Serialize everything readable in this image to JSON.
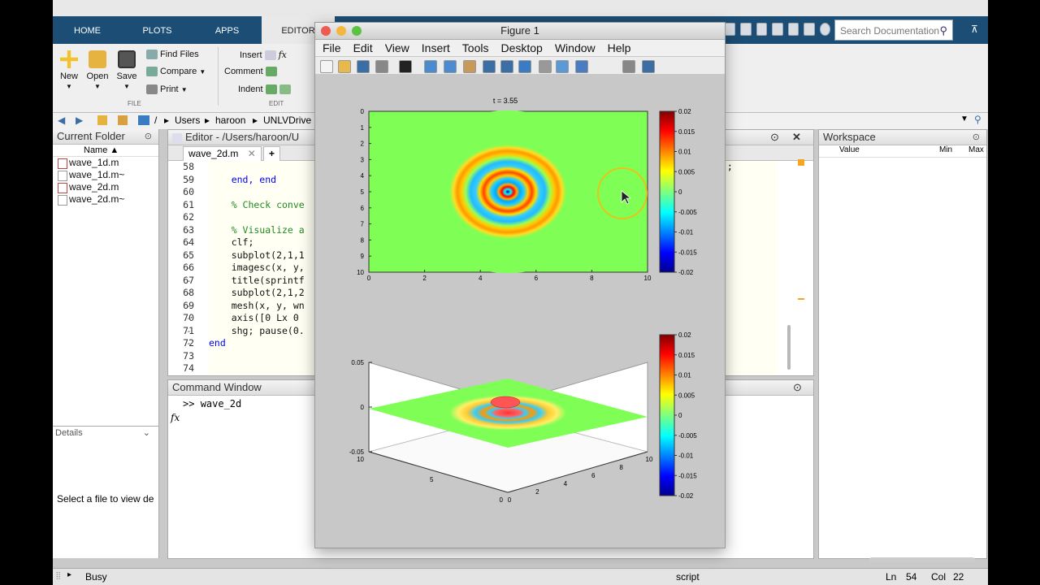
{
  "ribbon_tabs": [
    "HOME",
    "PLOTS",
    "APPS",
    "EDITOR"
  ],
  "search": {
    "placeholder": "Search Documentation"
  },
  "ribbon": {
    "new": "New",
    "open": "Open",
    "save": "Save",
    "find_files": "Find Files",
    "compare": "Compare",
    "print": "Print",
    "insert": "Insert",
    "comment": "Comment",
    "indent": "Indent",
    "fx": "fx",
    "group_file": "FILE",
    "group_edit": "EDIT"
  },
  "address": {
    "segments": [
      "/",
      "Users",
      "haroon",
      "UNLVDrive"
    ]
  },
  "current_folder": {
    "title": "Current Folder",
    "column": "Name ▲",
    "files": [
      "wave_1d.m",
      "wave_1d.m~",
      "wave_2d.m",
      "wave_2d.m~"
    ]
  },
  "details": {
    "title": "Details",
    "message": "Select a file to view de"
  },
  "editor": {
    "title": "Editor - /Users/haroon/U",
    "tab": "wave_2d.m",
    "line_numbers": [
      "58",
      "59",
      "60",
      "61",
      "62",
      "63",
      "64",
      "65",
      "66",
      "67",
      "68",
      "69",
      "70",
      "71",
      "72",
      "73",
      "74"
    ],
    "dashes": [
      "",
      "-",
      "",
      "",
      "",
      "-",
      "-",
      "-",
      "-",
      "-",
      "-",
      "-",
      "-",
      "-",
      "-",
      "",
      ""
    ],
    "code_visible": [
      "",
      "    end, end",
      "",
      "    % Check conve",
      "",
      "    % Visualize a",
      "    clf;",
      "    subplot(2,1,1",
      "    imagesc(x, y,",
      "    title(sprintf",
      "    subplot(2,1,2",
      "    mesh(x, y, wn",
      "    axis([0 Lx 0 ",
      "    shg; pause(0.",
      "end",
      "",
      ""
    ],
    "code_right_fragment": ");"
  },
  "command_window": {
    "title": "Command Window",
    "prompt": ">>",
    "command": "wave_2d",
    "fx": "fx"
  },
  "workspace": {
    "title": "Workspace",
    "columns": [
      "Value",
      "Min",
      "Max"
    ]
  },
  "status": {
    "left": "Busy",
    "mode": "script",
    "ln_label": "Ln",
    "ln": "54",
    "col_label": "Col",
    "col": "22"
  },
  "figure": {
    "title": "Figure 1",
    "menu": [
      "File",
      "Edit",
      "View",
      "Insert",
      "Tools",
      "Desktop",
      "Window",
      "Help"
    ],
    "tools_icons": [
      "new-figure-icon",
      "open-icon",
      "save-icon",
      "print-icon",
      "pointer-icon",
      "zoom-in-icon",
      "zoom-out-icon",
      "pan-icon",
      "rotate-icon",
      "data-cursor-icon",
      "brush-icon",
      "link-icon",
      "colorbar-icon",
      "legend-icon",
      "hide-tools-icon",
      "dock-icon"
    ]
  },
  "chart_data": [
    {
      "type": "heatmap",
      "title": "t = 3.55",
      "x_ticks": [
        0,
        2,
        4,
        6,
        8,
        10
      ],
      "y_ticks": [
        0,
        1,
        2,
        3,
        4,
        5,
        6,
        7,
        8,
        9,
        10
      ],
      "xlim": [
        0,
        10
      ],
      "ylim": [
        0,
        10
      ],
      "colorbar_ticks": [
        "0.02",
        "0.015",
        "0.01",
        "0.005",
        "0",
        "-0.005",
        "-0.01",
        "-0.015",
        "-0.02"
      ],
      "clim": [
        -0.02,
        0.02
      ],
      "description": "concentric wave rings centered at (5,5)"
    },
    {
      "type": "surface",
      "z_ticks": [
        "0.05",
        "0",
        "-0.05"
      ],
      "x_ticks": [
        "0",
        "2",
        "4",
        "6",
        "8",
        "10"
      ],
      "y_ticks": [
        "0",
        "5",
        "10"
      ],
      "zlim": [
        -0.05,
        0.05
      ],
      "colorbar_ticks": [
        "0.02",
        "0.015",
        "0.01",
        "0.005",
        "0",
        "-0.005",
        "-0.01",
        "-0.015",
        "-0.02"
      ]
    }
  ],
  "colors": {
    "tab_bar": "#1c4d75",
    "heat_bg": "#7fff55"
  }
}
